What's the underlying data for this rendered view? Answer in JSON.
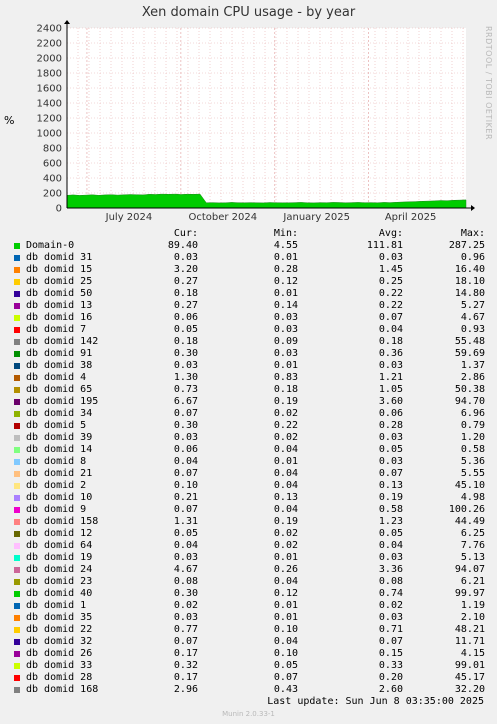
{
  "title": "Xen domain CPU usage - by year",
  "ylabel": "%",
  "side_label": "RRDTOOL / TOBI OETIKER",
  "legend_headers": {
    "cur": "Cur:",
    "min": "Min:",
    "avg": "Avg:",
    "max": "Max:"
  },
  "legend": [
    {
      "name": "Domain-0",
      "color": "#00cc00",
      "cur": "89.40",
      "min": "4.55",
      "avg": "111.81",
      "max": "287.25"
    },
    {
      "name": "db domid 31",
      "color": "#0066b3",
      "cur": "0.03",
      "min": "0.01",
      "avg": "0.03",
      "max": "0.96"
    },
    {
      "name": "db domid 15",
      "color": "#ff8000",
      "cur": "3.20",
      "min": "0.28",
      "avg": "1.45",
      "max": "16.40"
    },
    {
      "name": "db domid 25",
      "color": "#ffcc00",
      "cur": "0.27",
      "min": "0.12",
      "avg": "0.25",
      "max": "18.10"
    },
    {
      "name": "db domid 50",
      "color": "#330099",
      "cur": "0.18",
      "min": "0.01",
      "avg": "0.22",
      "max": "14.80"
    },
    {
      "name": "db domid 13",
      "color": "#990099",
      "cur": "0.27",
      "min": "0.14",
      "avg": "0.22",
      "max": "5.27"
    },
    {
      "name": "db domid 16",
      "color": "#ccff00",
      "cur": "0.06",
      "min": "0.03",
      "avg": "0.07",
      "max": "4.67"
    },
    {
      "name": "db domid 7",
      "color": "#ff0000",
      "cur": "0.05",
      "min": "0.03",
      "avg": "0.04",
      "max": "0.93"
    },
    {
      "name": "db domid 142",
      "color": "#808080",
      "cur": "0.18",
      "min": "0.09",
      "avg": "0.18",
      "max": "55.48"
    },
    {
      "name": "db domid 91",
      "color": "#008f00",
      "cur": "0.30",
      "min": "0.03",
      "avg": "0.36",
      "max": "59.69"
    },
    {
      "name": "db domid 38",
      "color": "#00487d",
      "cur": "0.03",
      "min": "0.01",
      "avg": "0.03",
      "max": "1.37"
    },
    {
      "name": "db domid 4",
      "color": "#b35a00",
      "cur": "1.30",
      "min": "0.83",
      "avg": "1.21",
      "max": "2.86"
    },
    {
      "name": "db domid 65",
      "color": "#b38f00",
      "cur": "0.73",
      "min": "0.18",
      "avg": "1.05",
      "max": "50.38"
    },
    {
      "name": "db domid 195",
      "color": "#6b006b",
      "cur": "6.67",
      "min": "0.19",
      "avg": "3.60",
      "max": "94.70"
    },
    {
      "name": "db domid 34",
      "color": "#8fb300",
      "cur": "0.07",
      "min": "0.02",
      "avg": "0.06",
      "max": "6.96"
    },
    {
      "name": "db domid 5",
      "color": "#b30000",
      "cur": "0.30",
      "min": "0.22",
      "avg": "0.28",
      "max": "0.79"
    },
    {
      "name": "db domid 39",
      "color": "#bebebe",
      "cur": "0.03",
      "min": "0.02",
      "avg": "0.03",
      "max": "1.20"
    },
    {
      "name": "db domid 14",
      "color": "#80ff80",
      "cur": "0.06",
      "min": "0.04",
      "avg": "0.05",
      "max": "0.58"
    },
    {
      "name": "db domid 8",
      "color": "#80c9ff",
      "cur": "0.04",
      "min": "0.01",
      "avg": "0.03",
      "max": "5.36"
    },
    {
      "name": "db domid 21",
      "color": "#ffc080",
      "cur": "0.07",
      "min": "0.04",
      "avg": "0.07",
      "max": "5.55"
    },
    {
      "name": "db domid 2",
      "color": "#ffe680",
      "cur": "0.10",
      "min": "0.04",
      "avg": "0.13",
      "max": "45.10"
    },
    {
      "name": "db domid 10",
      "color": "#aa80ff",
      "cur": "0.21",
      "min": "0.13",
      "avg": "0.19",
      "max": "4.98"
    },
    {
      "name": "db domid 9",
      "color": "#ee00cc",
      "cur": "0.07",
      "min": "0.04",
      "avg": "0.58",
      "max": "100.26"
    },
    {
      "name": "db domid 158",
      "color": "#ff8080",
      "cur": "1.31",
      "min": "0.19",
      "avg": "1.23",
      "max": "44.49"
    },
    {
      "name": "db domid 12",
      "color": "#666600",
      "cur": "0.05",
      "min": "0.02",
      "avg": "0.05",
      "max": "6.25"
    },
    {
      "name": "db domid 64",
      "color": "#ffbfff",
      "cur": "0.04",
      "min": "0.02",
      "avg": "0.04",
      "max": "7.76"
    },
    {
      "name": "db domid 19",
      "color": "#00ffcc",
      "cur": "0.03",
      "min": "0.01",
      "avg": "0.03",
      "max": "5.13"
    },
    {
      "name": "db domid 24",
      "color": "#cc6699",
      "cur": "4.67",
      "min": "0.26",
      "avg": "3.36",
      "max": "94.07"
    },
    {
      "name": "db domid 23",
      "color": "#999900",
      "cur": "0.08",
      "min": "0.04",
      "avg": "0.08",
      "max": "6.21"
    },
    {
      "name": "db domid 40",
      "color": "#00cc00",
      "cur": "0.30",
      "min": "0.12",
      "avg": "0.74",
      "max": "99.97"
    },
    {
      "name": "db domid 1",
      "color": "#0066b3",
      "cur": "0.02",
      "min": "0.01",
      "avg": "0.02",
      "max": "1.19"
    },
    {
      "name": "db domid 35",
      "color": "#ff8000",
      "cur": "0.03",
      "min": "0.01",
      "avg": "0.03",
      "max": "2.10"
    },
    {
      "name": "db domid 22",
      "color": "#ffcc00",
      "cur": "0.77",
      "min": "0.10",
      "avg": "0.71",
      "max": "48.21"
    },
    {
      "name": "db domid 32",
      "color": "#330099",
      "cur": "0.07",
      "min": "0.04",
      "avg": "0.07",
      "max": "11.71"
    },
    {
      "name": "db domid 26",
      "color": "#990099",
      "cur": "0.17",
      "min": "0.10",
      "avg": "0.15",
      "max": "4.15"
    },
    {
      "name": "db domid 33",
      "color": "#ccff00",
      "cur": "0.32",
      "min": "0.05",
      "avg": "0.33",
      "max": "99.01"
    },
    {
      "name": "db domid 28",
      "color": "#ff0000",
      "cur": "0.17",
      "min": "0.07",
      "avg": "0.20",
      "max": "45.17"
    },
    {
      "name": "db domid 168",
      "color": "#808080",
      "cur": "2.96",
      "min": "0.43",
      "avg": "2.60",
      "max": "32.20"
    }
  ],
  "last_update": "Last update:  Sun Jun  8 03:35:00 2025",
  "footer": "Munin 2.0.33-1",
  "chart_data": {
    "type": "area",
    "title": "Xen domain CPU usage - by year",
    "ylabel": "%",
    "ylim": [
      0,
      2400
    ],
    "yticks": [
      0,
      200,
      400,
      600,
      800,
      1000,
      1200,
      1400,
      1600,
      1800,
      2000,
      2200,
      2400
    ],
    "xticks": [
      "July 2024",
      "October 2024",
      "January 2025",
      "April 2025"
    ],
    "grid": true,
    "series": [
      {
        "name": "Domain-0 (stacked total)",
        "color": "#00cc00",
        "values": [
          170,
          175,
          168,
          172,
          176,
          170,
          174,
          178,
          172,
          176,
          180,
          178,
          175,
          182,
          180,
          185,
          182,
          186,
          180,
          184,
          182,
          185,
          70,
          72,
          68,
          70,
          74,
          71,
          69,
          72,
          70,
          68,
          73,
          71,
          70,
          69,
          72,
          74,
          70,
          68,
          72,
          71,
          75,
          73,
          70,
          72,
          74,
          71,
          72,
          70,
          74,
          72,
          76,
          80,
          82,
          85,
          90,
          92,
          95,
          100,
          98,
          102,
          105,
          108
        ]
      }
    ]
  }
}
